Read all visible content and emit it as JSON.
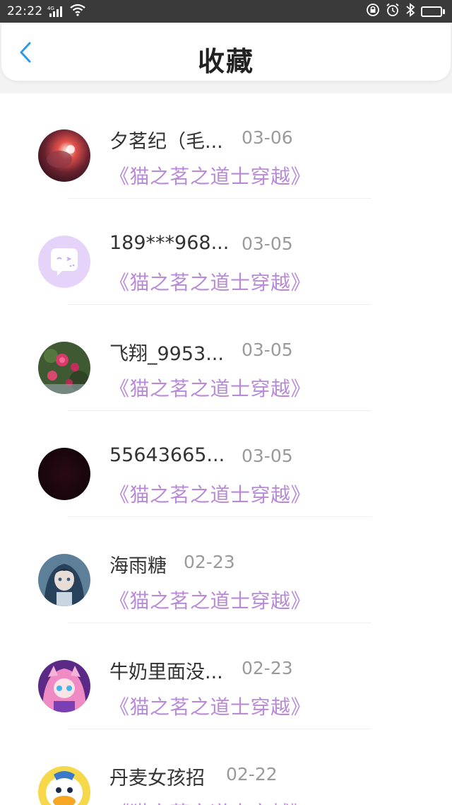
{
  "status_bar": {
    "time": "22:22",
    "network": "4G",
    "battery_level": 0.5
  },
  "header": {
    "title": "收藏"
  },
  "items": [
    {
      "name": "夕茗纪（毛...",
      "date": "03-06",
      "book": "《猫之茗之道士穿越》",
      "avatar_icon": "glowing-portrait-avatar"
    },
    {
      "name": "189***968...",
      "date": "03-05",
      "book": "《猫之茗之道士穿越》",
      "avatar_icon": "default-chat-bubble-avatar"
    },
    {
      "name": "飞翔_9953...",
      "date": "03-05",
      "book": "《猫之茗之道士穿越》",
      "avatar_icon": "flower-avatar"
    },
    {
      "name": "55643665...",
      "date": "03-05",
      "book": "《猫之茗之道士穿越》",
      "avatar_icon": "dark-avatar"
    },
    {
      "name": "海雨糖",
      "date": "02-23",
      "book": "《猫之茗之道士穿越》",
      "avatar_icon": "anime-girl-blue-avatar"
    },
    {
      "name": "牛奶里面没...",
      "date": "02-23",
      "book": "《猫之茗之道士穿越》",
      "avatar_icon": "anime-girl-pink-avatar"
    },
    {
      "name": "丹麦女孩招",
      "date": "02-22",
      "book": "《猫之茗之道士穿越》",
      "avatar_icon": "duck-avatar"
    }
  ],
  "colors": {
    "status_bar_bg": "#3a3a3a",
    "accent_blue": "#2f9be8",
    "book_title_purple": "#b98ad8",
    "date_gray": "#9a9a9a"
  }
}
